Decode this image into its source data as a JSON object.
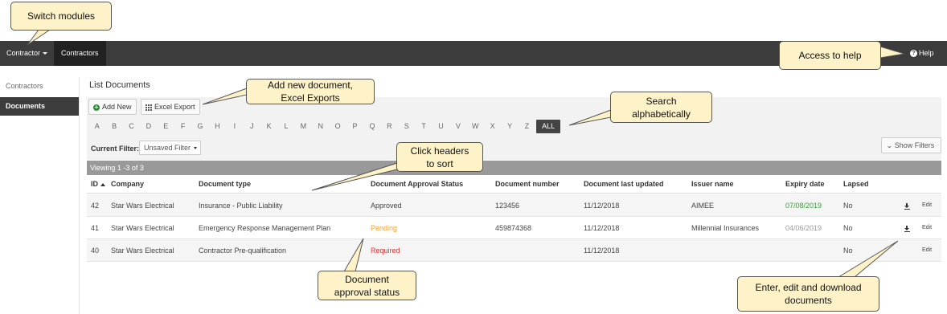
{
  "navbar": {
    "module_label": "Contractor",
    "active_tab": "Contractors",
    "help_label": "Help"
  },
  "sidebar": {
    "items": [
      {
        "label": "Contractors",
        "active": false
      },
      {
        "label": "Documents",
        "active": true
      }
    ]
  },
  "main": {
    "title": "List Documents",
    "add_new_label": "Add New",
    "excel_export_label": "Excel Export",
    "alphabet": [
      "A",
      "B",
      "C",
      "D",
      "E",
      "F",
      "G",
      "H",
      "I",
      "J",
      "K",
      "L",
      "M",
      "N",
      "O",
      "P",
      "Q",
      "R",
      "S",
      "T",
      "U",
      "V",
      "W",
      "X",
      "Y",
      "Z"
    ],
    "all_label": "ALL",
    "current_filter_label": "Current Filter:",
    "current_filter_value": "Unsaved Filter",
    "show_filters_label": "Show Filters",
    "viewing_text": "Viewing 1 -3 of 3"
  },
  "table": {
    "headers": [
      "ID",
      "Company",
      "Document type",
      "Document Approval Status",
      "Document number",
      "Document last updated",
      "Issuer name",
      "Expiry date",
      "Lapsed"
    ],
    "rows": [
      {
        "id": "42",
        "company": "Star Wars Electrical",
        "doc_type": "Insurance - Public Liability",
        "status": "Approved",
        "doc_number": "123456",
        "updated": "11/12/2018",
        "issuer": "AIMEE",
        "expiry": "07/08/2019",
        "lapsed": "No",
        "edit": "Edit"
      },
      {
        "id": "41",
        "company": "Star Wars Electrical",
        "doc_type": "Emergency Response Management Plan",
        "status": "Pending",
        "doc_number": "459874368",
        "updated": "11/12/2018",
        "issuer": "Millennial Insurances",
        "expiry": "04/06/2019",
        "lapsed": "No",
        "edit": "Edit"
      },
      {
        "id": "40",
        "company": "Star Wars Electrical",
        "doc_type": "Contractor Pre-qualification",
        "status": "Required",
        "doc_number": "",
        "updated": "11/12/2018",
        "issuer": "",
        "expiry": "",
        "lapsed": "No",
        "edit": "Edit"
      }
    ]
  },
  "callouts": {
    "switch_modules": "Switch modules",
    "access_help": "Access to help",
    "add_new_doc": "Add new document,\nExcel Exports",
    "search_alpha": "Search\nalphabetically",
    "click_headers": "Click headers\nto sort",
    "approval_status": "Document\napproval  status",
    "enter_edit": "Enter, edit and download\ndocuments"
  },
  "colors": {
    "navbar": "#3c3c3c",
    "callout_fill": "#fdf2c8",
    "status_pending": "#f0a030",
    "status_required": "#dd3333",
    "expiry_valid": "#3a9a3a"
  }
}
